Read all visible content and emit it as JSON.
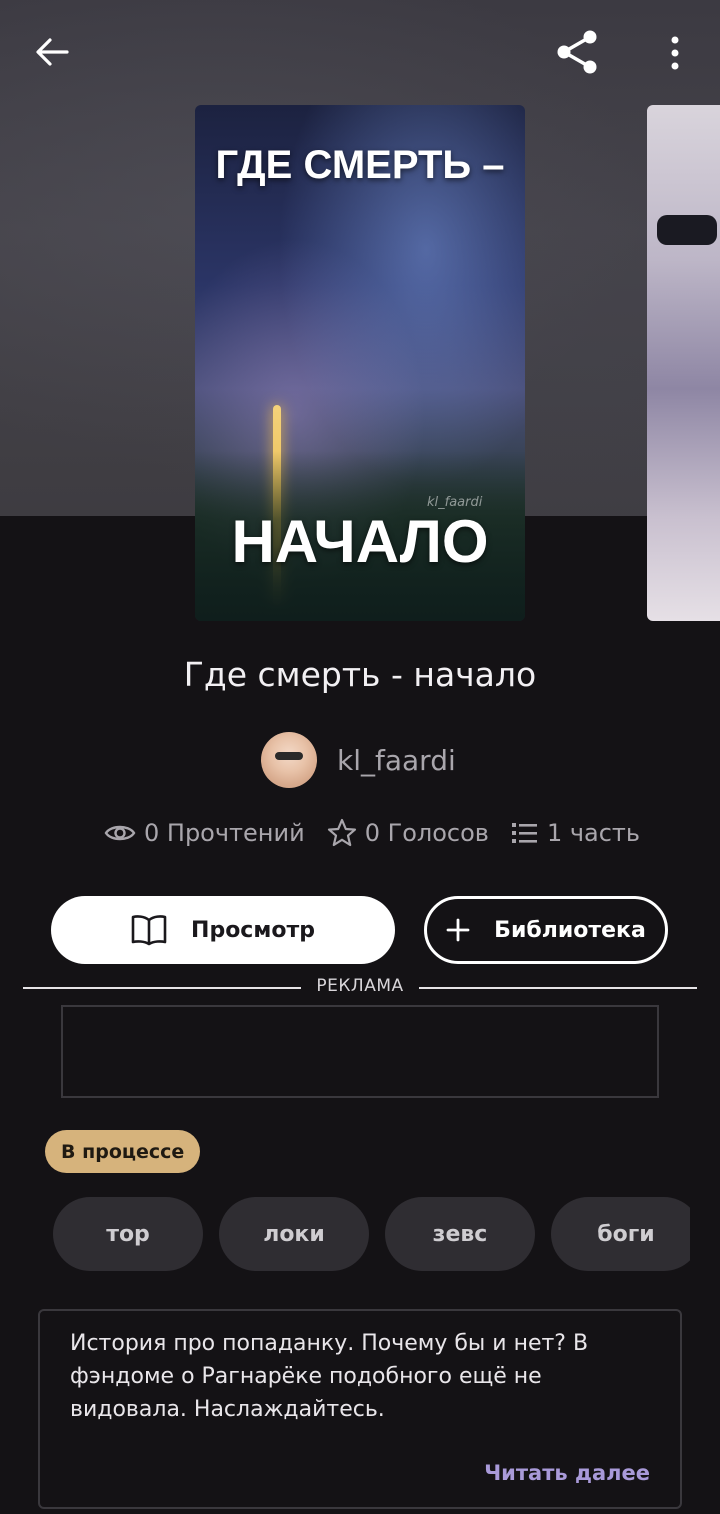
{
  "header": {
    "back_icon": "arrow-left-icon",
    "share_icon": "share-icon",
    "more_icon": "more-vertical-icon"
  },
  "cover": {
    "title_top": "ГДЕ СМЕРТЬ –",
    "title_bottom": "НАЧАЛО",
    "signature": "kl_faardi"
  },
  "book": {
    "title": "Где смерть - начало",
    "author": "kl_faardi"
  },
  "stats": {
    "reads": "0 Прочтений",
    "votes": "0 Голосов",
    "parts": "1 часть"
  },
  "actions": {
    "view_label": "Просмотр",
    "library_label": "Библиотека"
  },
  "ad": {
    "label": "РЕКЛАМА"
  },
  "status": "В процессе",
  "tags": [
    "тор",
    "локи",
    "зевс",
    "боги"
  ],
  "description": {
    "text": "История про попаданку. Почему бы и нет? В фэндоме о Рагнарёке подобного ещё не видовала. Наслаждайтесь.",
    "read_more": "Читать далее"
  },
  "colors": {
    "background": "#141215",
    "status_badge": "#d6b37c",
    "read_more": "#a99ad9"
  }
}
